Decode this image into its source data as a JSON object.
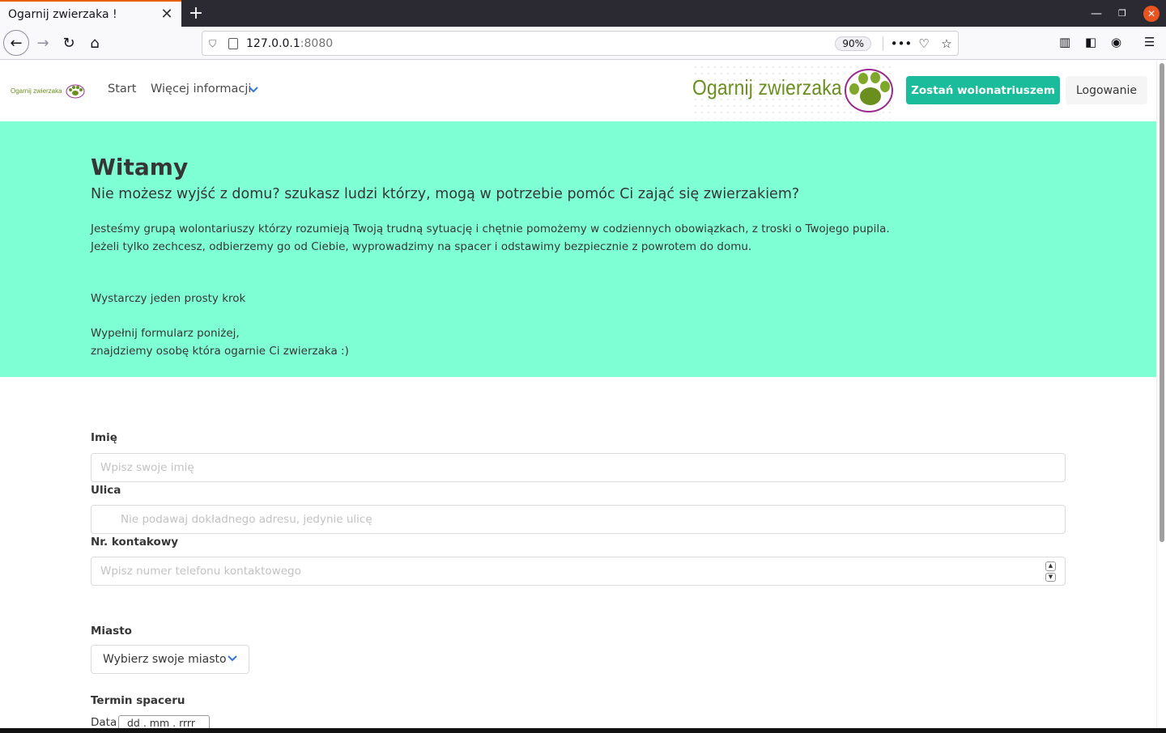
{
  "browser": {
    "tab_title": "Ogarnij zwierzaka !",
    "url_host": "127.0.0.1",
    "url_port": ":8080",
    "zoom": "90%"
  },
  "site": {
    "small_logo_text": "Ogarnij zwierzaka",
    "big_logo_text": "Ogarnij zwierzaka",
    "nav_start": "Start",
    "nav_more": "Więcej informacji",
    "btn_volunteer": "Zostań wolonatriuszem",
    "btn_login": "Logowanie"
  },
  "hero": {
    "title": "Witamy",
    "subtitle": "Nie możesz wyjść z domu? szukasz ludzi którzy, mogą w potrzebie pomóc Ci zająć się zwierzakiem?",
    "p1": "Jesteśmy grupą wolontariuszy którzy rozumieją Twoją trudną sytuację i chętnie pomożemy w codziennych obowiązkach, z troski o Twojego pupila.",
    "p2": "Jeżeli tylko zechcesz, odbierzemy go od Ciebie, wyprowadzimy na spacer i odstawimy bezpiecznie z powrotem do domu.",
    "p3": "Wystarczy jeden prosty krok",
    "p4": "Wypełnij formularz poniżej,",
    "p5": "znajdziemy osobę która ogarnie Ci zwierzaka :)"
  },
  "form": {
    "name_label": "Imię",
    "name_placeholder": "Wpisz swoje imię",
    "street_label": "Ulica",
    "street_placeholder": "Nie podawaj dokładnego adresu, jedynie ulicę",
    "phone_label": "Nr. kontakowy",
    "phone_placeholder": "Wpisz numer telefonu kontaktowego",
    "city_label": "Miasto",
    "city_value": "Wybierz swoje miasto",
    "walk_label": "Termin spaceru",
    "date_label": "Data",
    "date_value": "dd . mm . rrrr"
  },
  "colors": {
    "hero_bg": "#7fffd4",
    "primary": "#1abc9c",
    "logo_green": "#6a8f1f",
    "paw_purple": "#9b2a8f"
  }
}
